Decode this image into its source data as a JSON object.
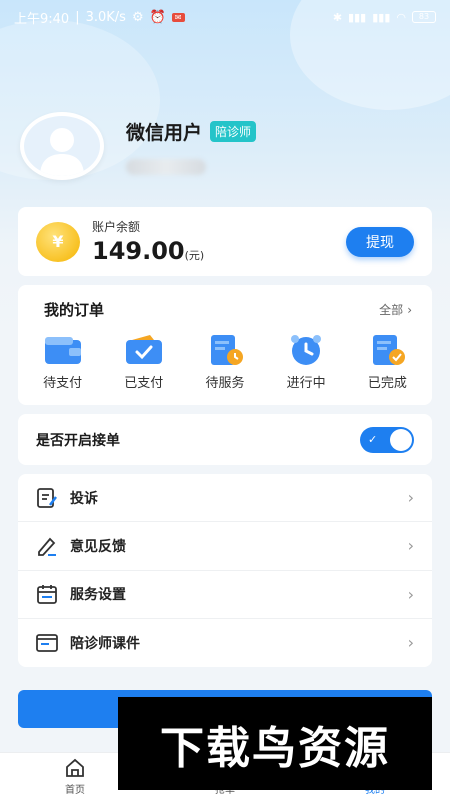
{
  "status_bar": {
    "time": "上午9:40",
    "network_speed": "3.0K/s",
    "battery": "83"
  },
  "profile": {
    "name": "微信用户",
    "role_badge": "陪诊师"
  },
  "balance": {
    "label": "账户余额",
    "amount": "149.00",
    "unit": "(元)",
    "coin_symbol": "¥",
    "withdraw_label": "提现"
  },
  "orders": {
    "title": "我的订单",
    "all_label": "全部",
    "items": [
      {
        "label": "待支付",
        "icon": "wallet-icon"
      },
      {
        "label": "已支付",
        "icon": "paid-wallet-icon"
      },
      {
        "label": "待服务",
        "icon": "clock-document-icon"
      },
      {
        "label": "进行中",
        "icon": "alarm-clock-icon"
      },
      {
        "label": "已完成",
        "icon": "check-document-icon"
      }
    ]
  },
  "accept_orders": {
    "label": "是否开启接单",
    "enabled": true
  },
  "menu": {
    "items": [
      {
        "label": "投诉",
        "icon": "complaint-icon"
      },
      {
        "label": "意见反馈",
        "icon": "pencil-icon"
      },
      {
        "label": "服务设置",
        "icon": "calendar-icon"
      },
      {
        "label": "陪诊师课件",
        "icon": "courseware-icon"
      }
    ]
  },
  "tab_bar": {
    "tabs": [
      {
        "label": "首页",
        "icon": "home-icon"
      },
      {
        "label": "抢单",
        "icon": "grab-order-icon"
      },
      {
        "label": "我的",
        "icon": "profile-icon"
      }
    ]
  },
  "watermark": {
    "text": "下载鸟资源"
  },
  "colors": {
    "accent": "#1e7ff0",
    "badge": "#24c4c9",
    "coin": "#f5b400"
  }
}
